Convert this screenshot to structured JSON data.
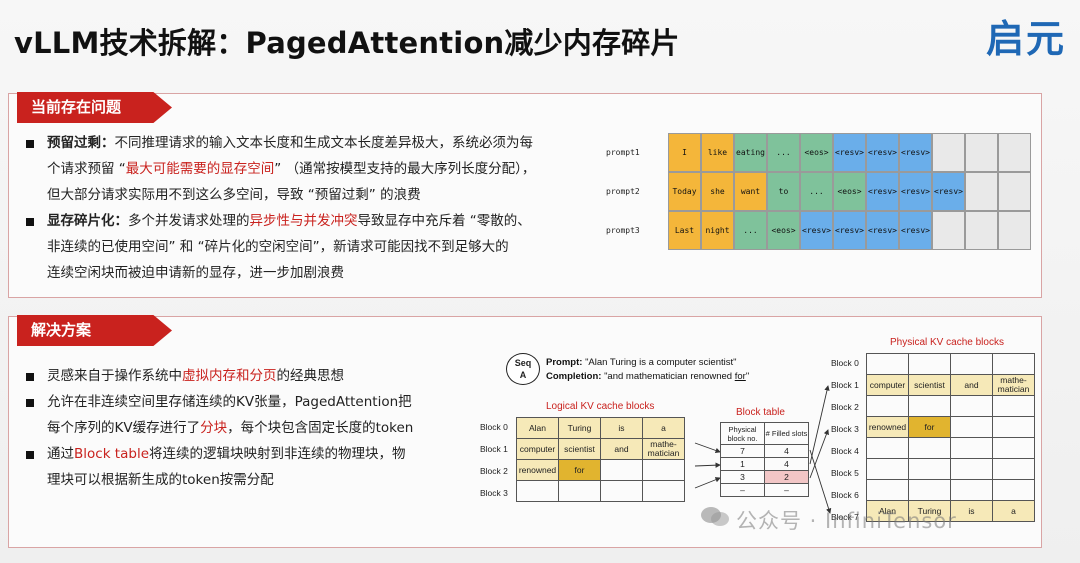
{
  "title": "vLLM技术拆解：PagedAttention减少内存碎片",
  "logo": "启元",
  "section1": {
    "header": "当前存在问题",
    "b1": {
      "label": "预留过剩：",
      "t1": "不同推理请求的输入文本长度和生成文本长度差异极大，系统必须为每",
      "t2a": "个请求预留 “",
      "t2red": "最大可能需要的显存空间",
      "t2b": "” （通常按模型支持的最大序列长度分配），",
      "t3": "但大部分请求实际用不到这么多空间，导致 “预留过剩” 的浪费"
    },
    "b2": {
      "label": "显存碎片化：",
      "t1a": "多个并发请求处理的",
      "t1red": "异步性与并发冲突",
      "t1b": "导致显存中充斥着 “零散的、",
      "t2": "非连续的已使用空间” 和 “碎片化的空闲空间”，新请求可能因找不到足够大的",
      "t3": "连续空闲块而被迫申请新的显存，进一步加剧浪费"
    },
    "prompts": [
      {
        "label": "prompt1",
        "cells": [
          {
            "t": "I",
            "c": "yel"
          },
          {
            "t": "like",
            "c": "yel"
          },
          {
            "t": "eating",
            "c": "grn"
          },
          {
            "t": "...",
            "c": "grn"
          },
          {
            "t": "<eos>",
            "c": "grn"
          },
          {
            "t": "<resv>",
            "c": "blu"
          },
          {
            "t": "<resv>",
            "c": "blu"
          },
          {
            "t": "<resv>",
            "c": "blu"
          },
          {
            "t": "",
            "c": "gry"
          },
          {
            "t": "",
            "c": "gry"
          },
          {
            "t": "",
            "c": "gry"
          }
        ]
      },
      {
        "label": "prompt2",
        "cells": [
          {
            "t": "Today",
            "c": "yel"
          },
          {
            "t": "she",
            "c": "yel"
          },
          {
            "t": "want",
            "c": "yel"
          },
          {
            "t": "to",
            "c": "grn"
          },
          {
            "t": "...",
            "c": "grn"
          },
          {
            "t": "<eos>",
            "c": "grn"
          },
          {
            "t": "<resv>",
            "c": "blu"
          },
          {
            "t": "<resv>",
            "c": "blu"
          },
          {
            "t": "<resv>",
            "c": "blu"
          },
          {
            "t": "",
            "c": "gry"
          },
          {
            "t": "",
            "c": "gry"
          }
        ]
      },
      {
        "label": "prompt3",
        "cells": [
          {
            "t": "Last",
            "c": "yel"
          },
          {
            "t": "night",
            "c": "yel"
          },
          {
            "t": "...",
            "c": "grn"
          },
          {
            "t": "<eos>",
            "c": "grn"
          },
          {
            "t": "<resv>",
            "c": "blu"
          },
          {
            "t": "<resv>",
            "c": "blu"
          },
          {
            "t": "<resv>",
            "c": "blu"
          },
          {
            "t": "<resv>",
            "c": "blu"
          },
          {
            "t": "",
            "c": "gry"
          },
          {
            "t": "",
            "c": "gry"
          },
          {
            "t": "",
            "c": "gry"
          }
        ]
      }
    ]
  },
  "section2": {
    "header": "解决方案",
    "b1": {
      "t1a": "灵感来自于操作系统中",
      "t1red": "虚拟内存和分页",
      "t1b": "的经典思想"
    },
    "b2": {
      "t1": "允许在非连续空间里存储连续的KV张量，PagedAttention把",
      "t2a": "每个序列的KV缓存进行了",
      "t2red": "分块",
      "t2b": "，每个块包含固定长度的token"
    },
    "b3": {
      "t1a": "通过",
      "t1red": "Block table",
      "t1b": "将连续的逻辑块映射到非连续的物理块，物",
      "t2": "理块可以根据新生成的token按需分配"
    }
  },
  "diagram": {
    "seq": "Seq\nA",
    "seq_l1": "Seq",
    "seq_l2": "A",
    "prompt_label": "Prompt:",
    "prompt_text": "\"Alan Turing is a computer scientist\"",
    "completion_label": "Completion:",
    "completion_text": "\"and mathematician renowned ",
    "completion_for": "for",
    "completion_end": "\"",
    "logical_title": "Logical KV cache blocks",
    "physical_title": "Physical KV cache blocks",
    "block_table_title": "Block table",
    "bt_h1": "Physical block no.",
    "bt_h2": "# Filled slots",
    "bt_rows": [
      [
        "7",
        "4"
      ],
      [
        "1",
        "4"
      ],
      [
        "3",
        "2"
      ],
      [
        "–",
        "–"
      ]
    ],
    "logical_labels": [
      "Block 0",
      "Block 1",
      "Block 2",
      "Block 3"
    ],
    "logical_rows": [
      [
        "Alan",
        "Turing",
        "is",
        "a"
      ],
      [
        "computer",
        "scientist",
        "and",
        "mathe-matician"
      ],
      [
        "renowned",
        "for",
        "",
        ""
      ],
      [
        "",
        "",
        "",
        ""
      ]
    ],
    "physical_labels": [
      "Block 0",
      "Block 1",
      "Block 2",
      "Block 3",
      "Block 4",
      "Block 5",
      "Block 6",
      "Block 7"
    ],
    "physical_rows": [
      [
        "",
        "",
        "",
        ""
      ],
      [
        "computer",
        "scientist",
        "and",
        "mathe-matician"
      ],
      [
        "",
        "",
        "",
        ""
      ],
      [
        "renowned",
        "for",
        "",
        ""
      ],
      [
        "",
        "",
        "",
        ""
      ],
      [
        "",
        "",
        "",
        ""
      ],
      [
        "",
        "",
        "",
        ""
      ],
      [
        "Alan",
        "Turing",
        "is",
        "a"
      ]
    ]
  },
  "watermark": "公众号 · InfiniTensor"
}
